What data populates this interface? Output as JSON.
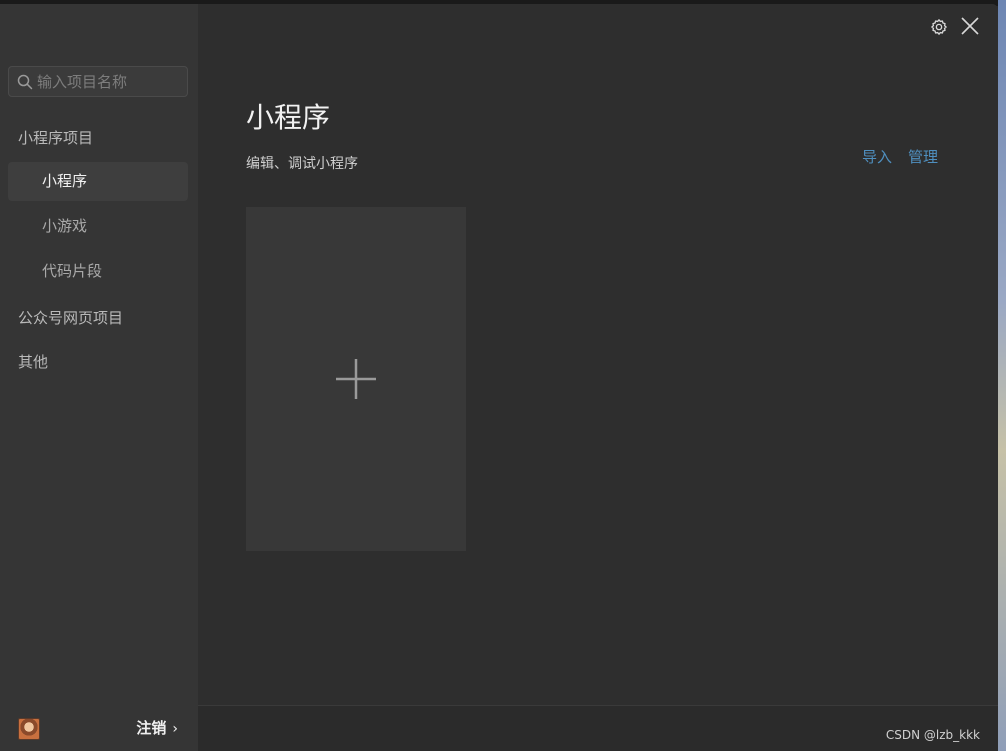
{
  "search": {
    "placeholder": "输入项目名称"
  },
  "sidebar": {
    "groups": [
      {
        "label": "小程序项目"
      },
      {
        "label": "公众号网页项目"
      },
      {
        "label": "其他"
      }
    ],
    "sub_items": [
      {
        "label": "小程序",
        "active": true
      },
      {
        "label": "小游戏",
        "active": false
      },
      {
        "label": "代码片段",
        "active": false
      }
    ],
    "footer": {
      "logout_label": "注销",
      "chevron": "›"
    }
  },
  "main": {
    "title": "小程序",
    "subtitle": "编辑、调试小程序",
    "actions": {
      "import_label": "导入",
      "manage_label": "管理"
    },
    "create_card": {
      "icon": "plus-icon"
    }
  },
  "header_icons": [
    "gear-icon",
    "close-icon"
  ],
  "watermark": "CSDN @lzb_kkk",
  "colors": {
    "sidebar_bg": "#353535",
    "main_bg": "#2e2e2e",
    "active_item_bg": "#3e3e3e",
    "link": "#4f8fbf",
    "card_bg": "#383838"
  }
}
